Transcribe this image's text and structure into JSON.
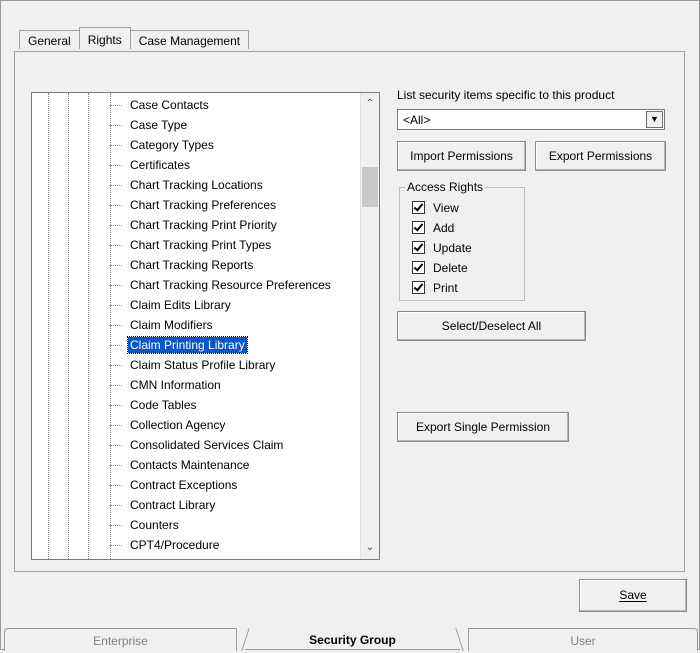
{
  "tabs": [
    {
      "label": "General"
    },
    {
      "label": "Rights"
    },
    {
      "label": "Case Management"
    }
  ],
  "tree": {
    "items": [
      "Case Contacts",
      "Case Type",
      "Category Types",
      "Certificates",
      "Chart Tracking Locations",
      "Chart Tracking Preferences",
      "Chart Tracking Print Priority",
      "Chart Tracking Print Types",
      "Chart Tracking Reports",
      "Chart Tracking Resource Preferences",
      "Claim Edits Library",
      "Claim Modifiers",
      "Claim Printing Library",
      "Claim Status Profile Library",
      "CMN Information",
      "Code Tables",
      "Collection Agency",
      "Consolidated Services Claim",
      "Contacts Maintenance",
      "Contract Exceptions",
      "Contract Library",
      "Counters",
      "CPT4/Procedure"
    ],
    "selected_index": 12
  },
  "security": {
    "list_label": "List security items specific to this product",
    "filter_value": "<All>"
  },
  "buttons": {
    "import": "Import Permissions",
    "export": "Export Permissions",
    "select_all": "Select/Deselect All",
    "export_single": "Export Single Permission",
    "save": "Save"
  },
  "access_rights": {
    "title": "Access Rights",
    "items": [
      {
        "label": "View",
        "checked": true
      },
      {
        "label": "Add",
        "checked": true
      },
      {
        "label": "Update",
        "checked": true
      },
      {
        "label": "Delete",
        "checked": true
      },
      {
        "label": "Print",
        "checked": true
      }
    ]
  },
  "bottom_tabs": [
    {
      "label": "Enterprise"
    },
    {
      "label": "Security Group"
    },
    {
      "label": "User"
    }
  ]
}
